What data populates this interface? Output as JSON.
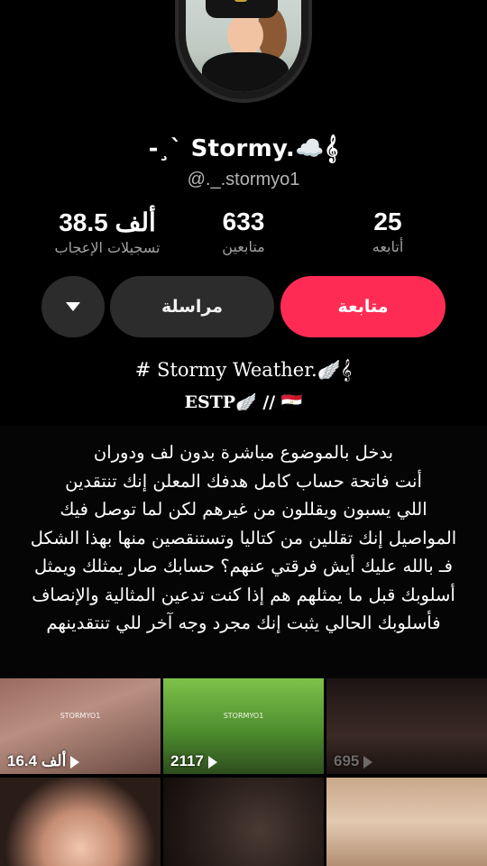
{
  "profile": {
    "display_name": "-¸` Stormy.☁️𝄞",
    "username": "@._.stormyo1"
  },
  "stats": {
    "likes": {
      "value": "38.5 ألف",
      "label": "تسجيلات الإعجاب"
    },
    "followers": {
      "value": "633",
      "label": "متابعين"
    },
    "following": {
      "value": "25",
      "label": "أتابعه"
    }
  },
  "actions": {
    "follow_label": "متابعة",
    "message_label": "مراسلة",
    "dropdown_icon": "triangle-down-icon"
  },
  "bio": {
    "line1": "# Stormy Weather.🪽𝄞",
    "line2": "ESTP🪽 //  🇪🇬"
  },
  "banner": {
    "lines": [
      "بدخل بالموضوع مباشرة بدون لف ودوران",
      "أنت فاتحة حساب كامل هدفك المعلن إنك تنتقدين",
      "اللي يسبون ويقللون من غيرهم لكن لما توصل فيك",
      "المواصيل إنك تقللين من كتاليا وتستنقصين منها بهذا الشكل",
      "فـ بالله عليك أيش فرقتي عنهم؟ حسابك صار يمثلك ويمثل",
      "أسلوبك قبل ما يمثلهم هم إذا كنت تدعين المثالية والإنصاف",
      "فأسلوبك الحالي يثبت إنك مجرد وجه آخر للي تنتقدينهم"
    ]
  },
  "videos": [
    {
      "views": "16.4 ألف",
      "caption": "STORMYO1"
    },
    {
      "views": "2117",
      "caption": "STORMYO1"
    },
    {
      "views": "695",
      "caption": ""
    },
    {
      "views": "",
      "caption": ""
    },
    {
      "views": "",
      "caption": ""
    },
    {
      "views": "",
      "caption": ""
    }
  ],
  "colors": {
    "background": "#000000",
    "follow_button": "#fe2c55",
    "secondary_button": "#2c2c2c",
    "muted_text": "#a0a0a0"
  }
}
